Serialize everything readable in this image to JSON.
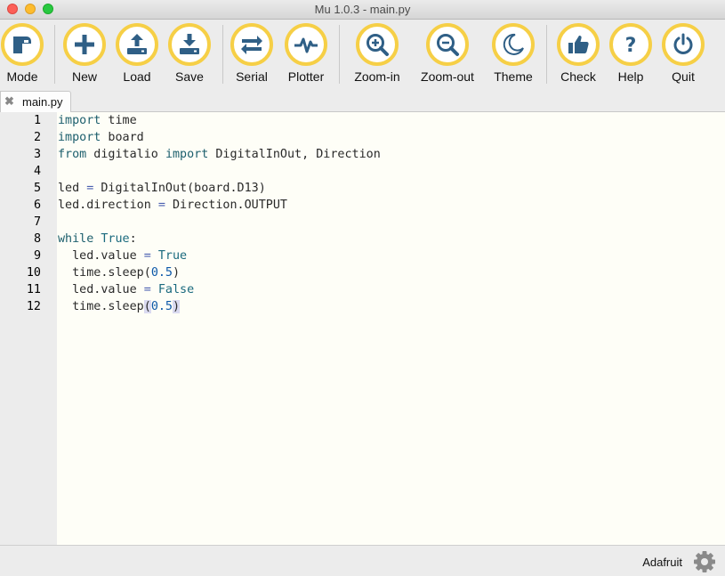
{
  "window": {
    "title": "Mu 1.0.3 - main.py"
  },
  "toolbar": {
    "buttons": [
      {
        "label": "Mode",
        "icon": "mode-icon"
      },
      {
        "label": "New",
        "icon": "plus-icon"
      },
      {
        "label": "Load",
        "icon": "upload-icon"
      },
      {
        "label": "Save",
        "icon": "download-icon"
      },
      {
        "label": "Serial",
        "icon": "swap-arrows-icon"
      },
      {
        "label": "Plotter",
        "icon": "pulse-icon"
      },
      {
        "label": "Zoom-in",
        "icon": "zoom-in-icon"
      },
      {
        "label": "Zoom-out",
        "icon": "zoom-out-icon"
      },
      {
        "label": "Theme",
        "icon": "moon-icon"
      },
      {
        "label": "Check",
        "icon": "thumbs-up-icon"
      },
      {
        "label": "Help",
        "icon": "question-icon"
      },
      {
        "label": "Quit",
        "icon": "power-icon"
      }
    ],
    "accent": "#f6cf46",
    "icon_color": "#2f5f86"
  },
  "tabs": [
    {
      "label": "main.py",
      "close": "✖"
    }
  ],
  "editor": {
    "lines": [
      {
        "n": "1",
        "text": "import time"
      },
      {
        "n": "2",
        "text": "import board"
      },
      {
        "n": "3",
        "text": "from digitalio import DigitalInOut, Direction"
      },
      {
        "n": "4",
        "text": ""
      },
      {
        "n": "5",
        "text": "led = DigitalInOut(board.D13)"
      },
      {
        "n": "6",
        "text": "led.direction = Direction.OUTPUT"
      },
      {
        "n": "7",
        "text": ""
      },
      {
        "n": "8",
        "text": "while True:"
      },
      {
        "n": "9",
        "text": "  led.value = True"
      },
      {
        "n": "10",
        "text": "  time.sleep(0.5)"
      },
      {
        "n": "11",
        "text": "  led.value = False"
      },
      {
        "n": "12",
        "text": "  time.sleep(0.5)"
      }
    ]
  },
  "status": {
    "mode": "Adafruit",
    "settings_icon": "gear-icon"
  }
}
